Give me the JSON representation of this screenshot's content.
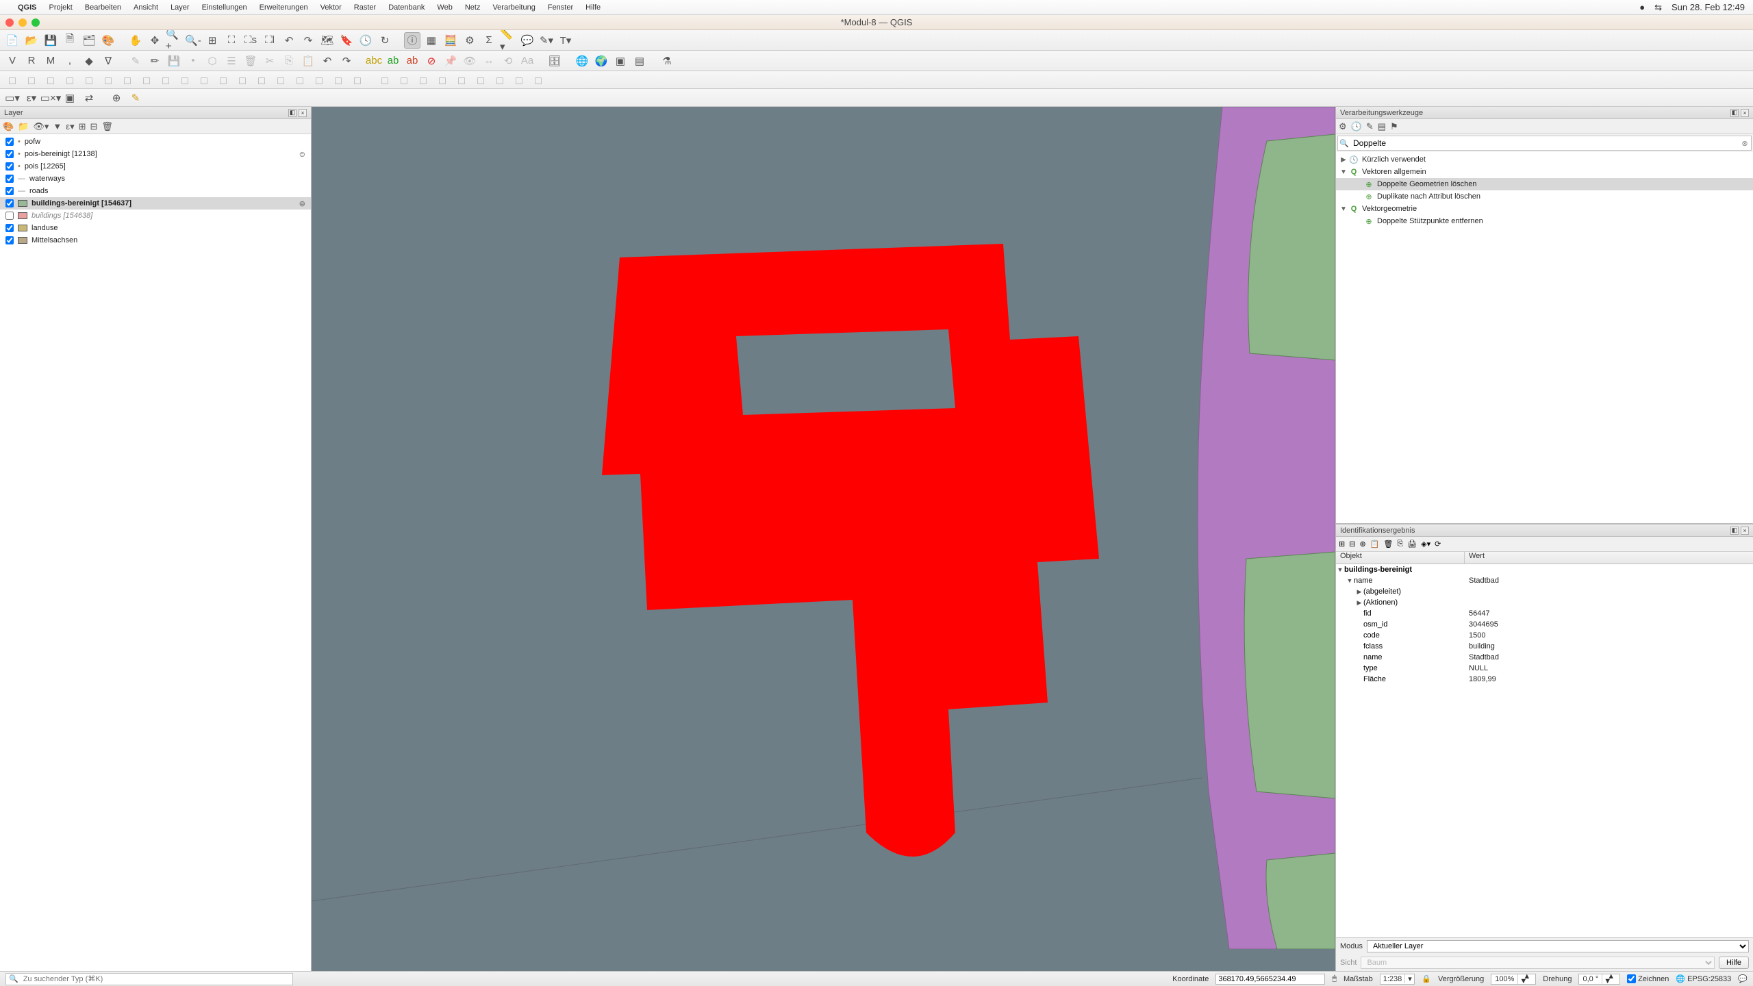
{
  "mac_menubar": {
    "app": "QGIS",
    "items": [
      "Projekt",
      "Bearbeiten",
      "Ansicht",
      "Layer",
      "Einstellungen",
      "Erweiterungen",
      "Vektor",
      "Raster",
      "Datenbank",
      "Web",
      "Netz",
      "Verarbeitung",
      "Fenster",
      "Hilfe"
    ],
    "clock": "Sun 28. Feb  12:49"
  },
  "window_title": "*Modul-8 — QGIS",
  "layers": {
    "panel_title": "Layer",
    "items": [
      {
        "checked": true,
        "kind": "point",
        "label": "pofw"
      },
      {
        "checked": true,
        "kind": "point",
        "label": "pois-bereinigt [12138]",
        "filter": true
      },
      {
        "checked": true,
        "kind": "point",
        "label": "pois [12265]"
      },
      {
        "checked": true,
        "kind": "line",
        "label": "waterways"
      },
      {
        "checked": true,
        "kind": "line",
        "label": "roads"
      },
      {
        "checked": true,
        "kind": "poly",
        "swatch": "#98b898",
        "label": "buildings-bereinigt [154637]",
        "selected": true,
        "filter": true
      },
      {
        "checked": false,
        "kind": "poly",
        "swatch": "#e8a0a0",
        "label": "buildings [154638]",
        "dim": true
      },
      {
        "checked": true,
        "kind": "poly",
        "swatch": "#c8b878",
        "label": "landuse"
      },
      {
        "checked": true,
        "kind": "poly",
        "swatch": "#b8a888",
        "label": "Mittelsachsen"
      }
    ]
  },
  "processing": {
    "panel_title": "Verarbeitungswerkzeuge",
    "search_value": "Doppelte",
    "groups": [
      {
        "label": "Kürzlich verwendet",
        "icon": "clock",
        "expanded": false
      },
      {
        "label": "Vektoren allgemein",
        "icon": "qgis",
        "expanded": true,
        "children": [
          {
            "label": "Doppelte Geometrien löschen",
            "selected": true
          },
          {
            "label": "Duplikate nach Attribut löschen"
          }
        ]
      },
      {
        "label": "Vektorgeometrie",
        "icon": "qgis",
        "expanded": true,
        "children": [
          {
            "label": "Doppelte Stützpunkte entfernen"
          }
        ]
      }
    ]
  },
  "identify": {
    "panel_title": "Identifikationsergebnis",
    "col_object": "Objekt",
    "col_value": "Wert",
    "layer_name": "buildings-bereinigt",
    "feature_title_key": "name",
    "feature_title_val": "Stadtbad",
    "derived": "(abgeleitet)",
    "actions": "(Aktionen)",
    "attrs": [
      {
        "k": "fid",
        "v": "56447"
      },
      {
        "k": "osm_id",
        "v": "3044695"
      },
      {
        "k": "code",
        "v": "1500"
      },
      {
        "k": "fclass",
        "v": "building"
      },
      {
        "k": "name",
        "v": "Stadtbad"
      },
      {
        "k": "type",
        "v": "NULL"
      },
      {
        "k": "Fläche",
        "v": "1809,99"
      }
    ],
    "mode_label": "Modus",
    "mode_value": "Aktueller Layer",
    "view_label": "Sicht",
    "view_value": "Baum",
    "help": "Hilfe"
  },
  "statusbar": {
    "locator_placeholder": "Zu suchender Typ (⌘K)",
    "coord_label": "Koordinate",
    "coord_value": "368170.49,5665234.49",
    "scale_label": "Maßstab",
    "scale_value": "1:238",
    "mag_label": "Vergrößerung",
    "mag_value": "100%",
    "rot_label": "Drehung",
    "rot_value": "0,0 °",
    "render_label": "Zeichnen",
    "crs": "EPSG:25833"
  }
}
